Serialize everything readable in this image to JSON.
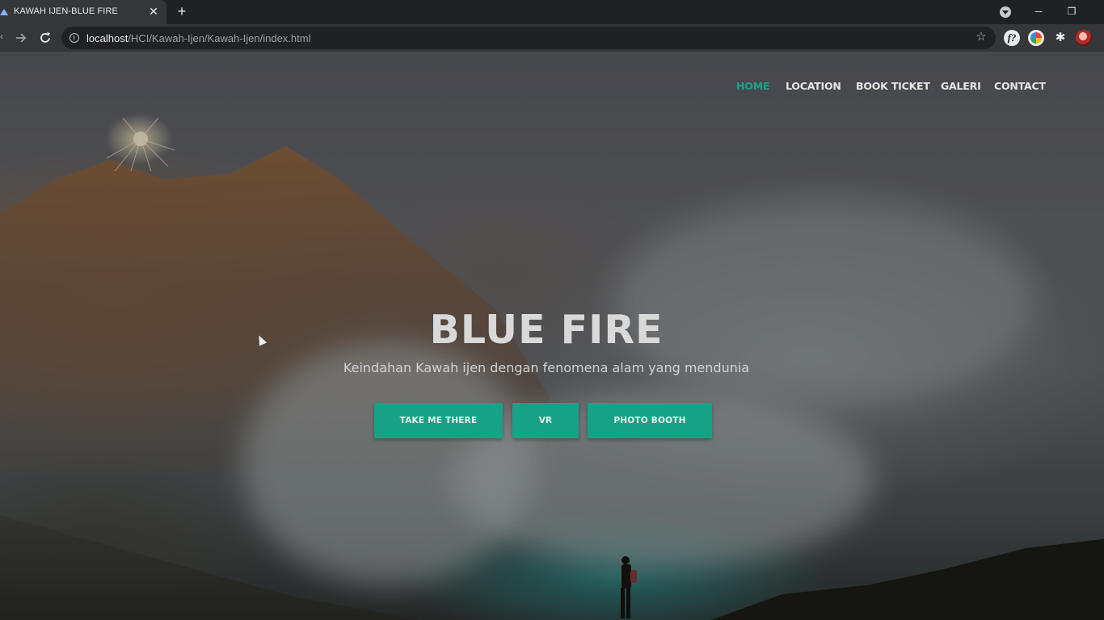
{
  "browser": {
    "tab_title": "KAWAH IJEN-BLUE FIRE",
    "tab_close": "✕",
    "new_tab": "+",
    "url_host": "localhost",
    "url_path": "/HCI/Kawah-Ijen/Kawah-Ijen/index.html",
    "window_controls": {
      "minimize": "─",
      "restore": "❐"
    },
    "extensions": {
      "f_label": "f?"
    },
    "icons": [
      "back-arrow-icon",
      "forward-arrow-icon",
      "reload-icon",
      "info-icon",
      "star-icon",
      "puzzle-icon"
    ]
  },
  "nav": {
    "items": [
      {
        "label": "HOME",
        "active": true
      },
      {
        "label": "LOCATION",
        "active": false
      },
      {
        "label": "BOOK TICKET",
        "active": false
      },
      {
        "label": "GALERI",
        "active": false
      },
      {
        "label": "CONTACT",
        "active": false
      }
    ]
  },
  "hero": {
    "title": "BLUE FIRE",
    "subtitle": "Keindahan Kawah ijen dengan fenomena alam yang mendunia",
    "buttons": [
      {
        "label": "TAKE ME THERE"
      },
      {
        "label": "VR"
      },
      {
        "label": "PHOTO BOOTH"
      }
    ]
  },
  "colors": {
    "accent": "#17a285",
    "nav_active": "#1ba488",
    "chrome_dark": "#202124",
    "chrome_toolbar": "#35363a"
  }
}
